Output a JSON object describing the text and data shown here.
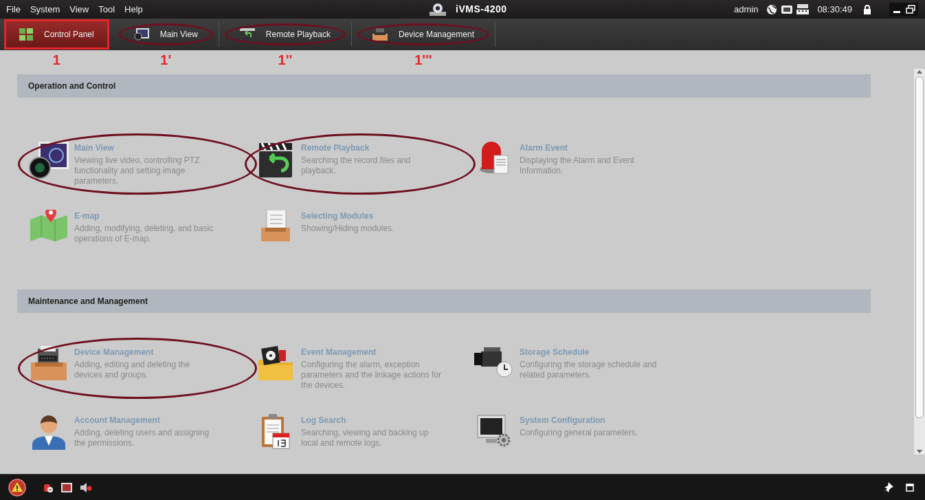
{
  "menu": [
    {
      "label": "File"
    },
    {
      "label": "System"
    },
    {
      "label": "View"
    },
    {
      "label": "Tool"
    },
    {
      "label": "Help"
    }
  ],
  "app_title": "iVMS-4200",
  "status": {
    "user": "admin",
    "time": "08:30:49"
  },
  "tabs": [
    {
      "label": "Control Panel",
      "selected": true,
      "annotation": "1"
    },
    {
      "label": "Main View",
      "selected": false,
      "annotation": "1'"
    },
    {
      "label": "Remote Playback",
      "selected": false,
      "annotation": "1''"
    },
    {
      "label": "Device Management",
      "selected": false,
      "annotation": "1'''"
    }
  ],
  "sections": [
    {
      "title": "Operation and Control",
      "modules": [
        {
          "title": "Main View",
          "description": "Viewing live video, controlling PTZ functionality and setting image parameters.",
          "circled": true
        },
        {
          "title": "Remote Playback",
          "description": "Searching the record files and playback.",
          "circled": true
        },
        {
          "title": "Alarm Event",
          "description": "Displaying the Alarm and Event Information.",
          "circled": false
        },
        {
          "title": "E-map",
          "description": "Adding, modifying, deleting, and basic operations of E-map.",
          "circled": false
        },
        {
          "title": "Selecting Modules",
          "description": "Showing/Hiding modules.",
          "circled": false
        }
      ]
    },
    {
      "title": "Maintenance and Management",
      "modules": [
        {
          "title": "Device Management",
          "description": "Adding, editing and deleting the devices and groups.",
          "circled": true
        },
        {
          "title": "Event Management",
          "description": "Configuring the alarm, exception parameters and the linkage actions for the devices.",
          "circled": false
        },
        {
          "title": "Storage Schedule",
          "description": "Configuring the storage schedule and related parameters.",
          "circled": false
        },
        {
          "title": "Account Management",
          "description": "Adding, deleting users and assigning the permissions.",
          "circled": false
        },
        {
          "title": "Log Search",
          "description": "Searching, viewing and backing up local and remote logs.",
          "circled": false
        },
        {
          "title": "System Configuration",
          "description": "Configuring general parameters.",
          "circled": false
        }
      ]
    }
  ]
}
